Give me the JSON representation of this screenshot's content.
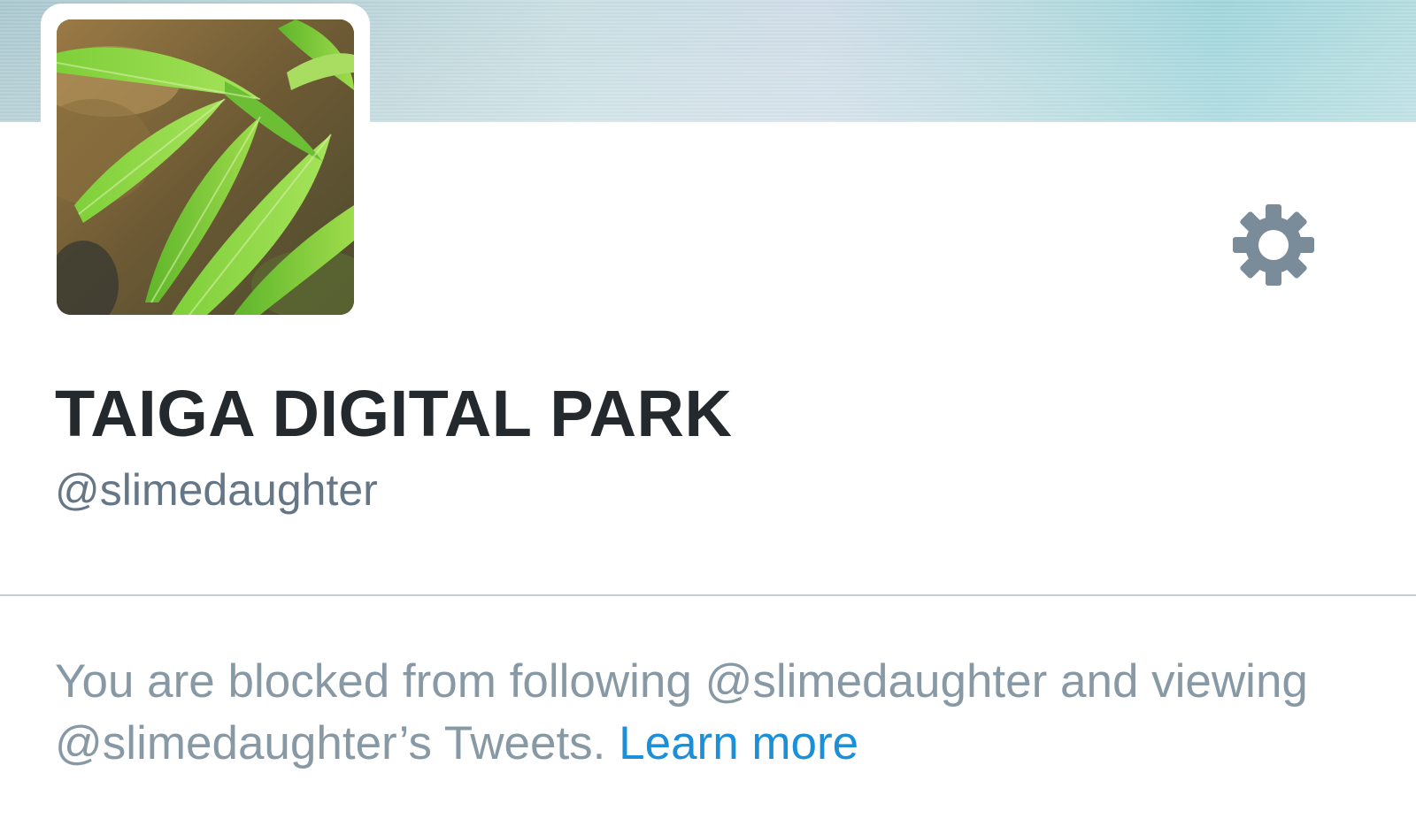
{
  "profile": {
    "display_name": "TAIGA DIGITAL PARK",
    "handle": "@slimedaughter",
    "avatar_icon": "profile-photo-leaves"
  },
  "toolbar": {
    "settings_icon": "gear-icon"
  },
  "notice": {
    "message": "You are blocked from following @slimedaughter and viewing @slimedaughter’s Tweets.",
    "link_label": "Learn more"
  },
  "colors": {
    "name_text": "#24292e",
    "secondary_text": "#657786",
    "notice_text": "#8899a6",
    "link": "#1b8fd8",
    "gear": "#7a8c99",
    "divider": "#c5ccd3"
  }
}
